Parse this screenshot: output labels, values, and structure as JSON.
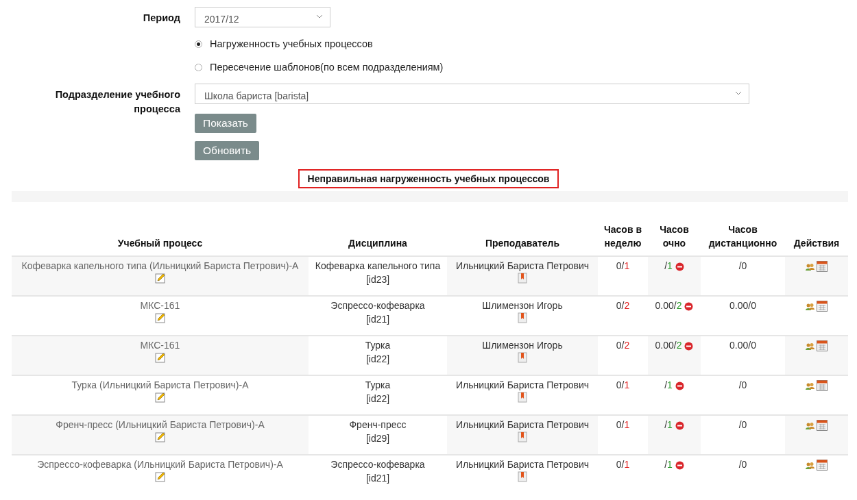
{
  "form": {
    "period_label": "Период",
    "period_value": "2017/12",
    "modes": [
      {
        "label": "Нагруженность учебных процессов",
        "selected": true
      },
      {
        "label": "Пересечение шаблонов(по всем подразделениям)",
        "selected": false
      }
    ],
    "unit_label": "Подразделение учебного процесса",
    "unit_value": "Школа бариста [barista]",
    "buttons": [
      "Показать",
      "Обновить"
    ]
  },
  "report_title": "Неправильная нагруженность учебных процессов",
  "table": {
    "columns": [
      "Учебный процесс",
      "Дисциплина",
      "Преподаватель",
      "Часов в неделю",
      "Часов очно",
      "Часов дистанционно",
      "Действия"
    ],
    "rows": [
      {
        "process": "Кофеварка капельного типа (Ильницкий Бариста Петрович)-А",
        "discipline": "Кофеварка капельного типа",
        "discipline_id": "[id23]",
        "teacher": "Ильницкий Бариста Петрович",
        "week_done": "0/",
        "week_plan": "1",
        "fulltime_done": "/",
        "fulltime_plan": "1",
        "distance": "/0"
      },
      {
        "process": "МКС-161",
        "discipline": "Эспрессо-кофеварка",
        "discipline_id": "[id21]",
        "teacher": "Шлимензон Игорь",
        "week_done": "0/",
        "week_plan": "2",
        "fulltime_done": "0.00/",
        "fulltime_plan": "2",
        "distance": "0.00/0"
      },
      {
        "process": "МКС-161",
        "discipline": "Турка",
        "discipline_id": "[id22]",
        "teacher": "Шлимензон Игорь",
        "week_done": "0/",
        "week_plan": "2",
        "fulltime_done": "0.00/",
        "fulltime_plan": "2",
        "distance": "0.00/0"
      },
      {
        "process": "Турка (Ильницкий Бариста Петрович)-А",
        "discipline": "Турка",
        "discipline_id": "[id22]",
        "teacher": "Ильницкий Бариста Петрович",
        "week_done": "0/",
        "week_plan": "1",
        "fulltime_done": "/",
        "fulltime_plan": "1",
        "distance": "/0"
      },
      {
        "process": "Френч-пресс (Ильницкий Бариста Петрович)-А",
        "discipline": "Френч-пресс",
        "discipline_id": "[id29]",
        "teacher": "Ильницкий Бариста Петрович",
        "week_done": "0/",
        "week_plan": "1",
        "fulltime_done": "/",
        "fulltime_plan": "1",
        "distance": "/0"
      },
      {
        "process": "Эспрессо-кофеварка (Ильницкий Бариста Петрович)-А",
        "discipline": "Эспрессо-кофеварка",
        "discipline_id": "[id21]",
        "teacher": "Ильницкий Бариста Петрович",
        "week_done": "0/",
        "week_plan": "1",
        "fulltime_done": "/",
        "fulltime_plan": "1",
        "distance": "/0"
      }
    ]
  }
}
